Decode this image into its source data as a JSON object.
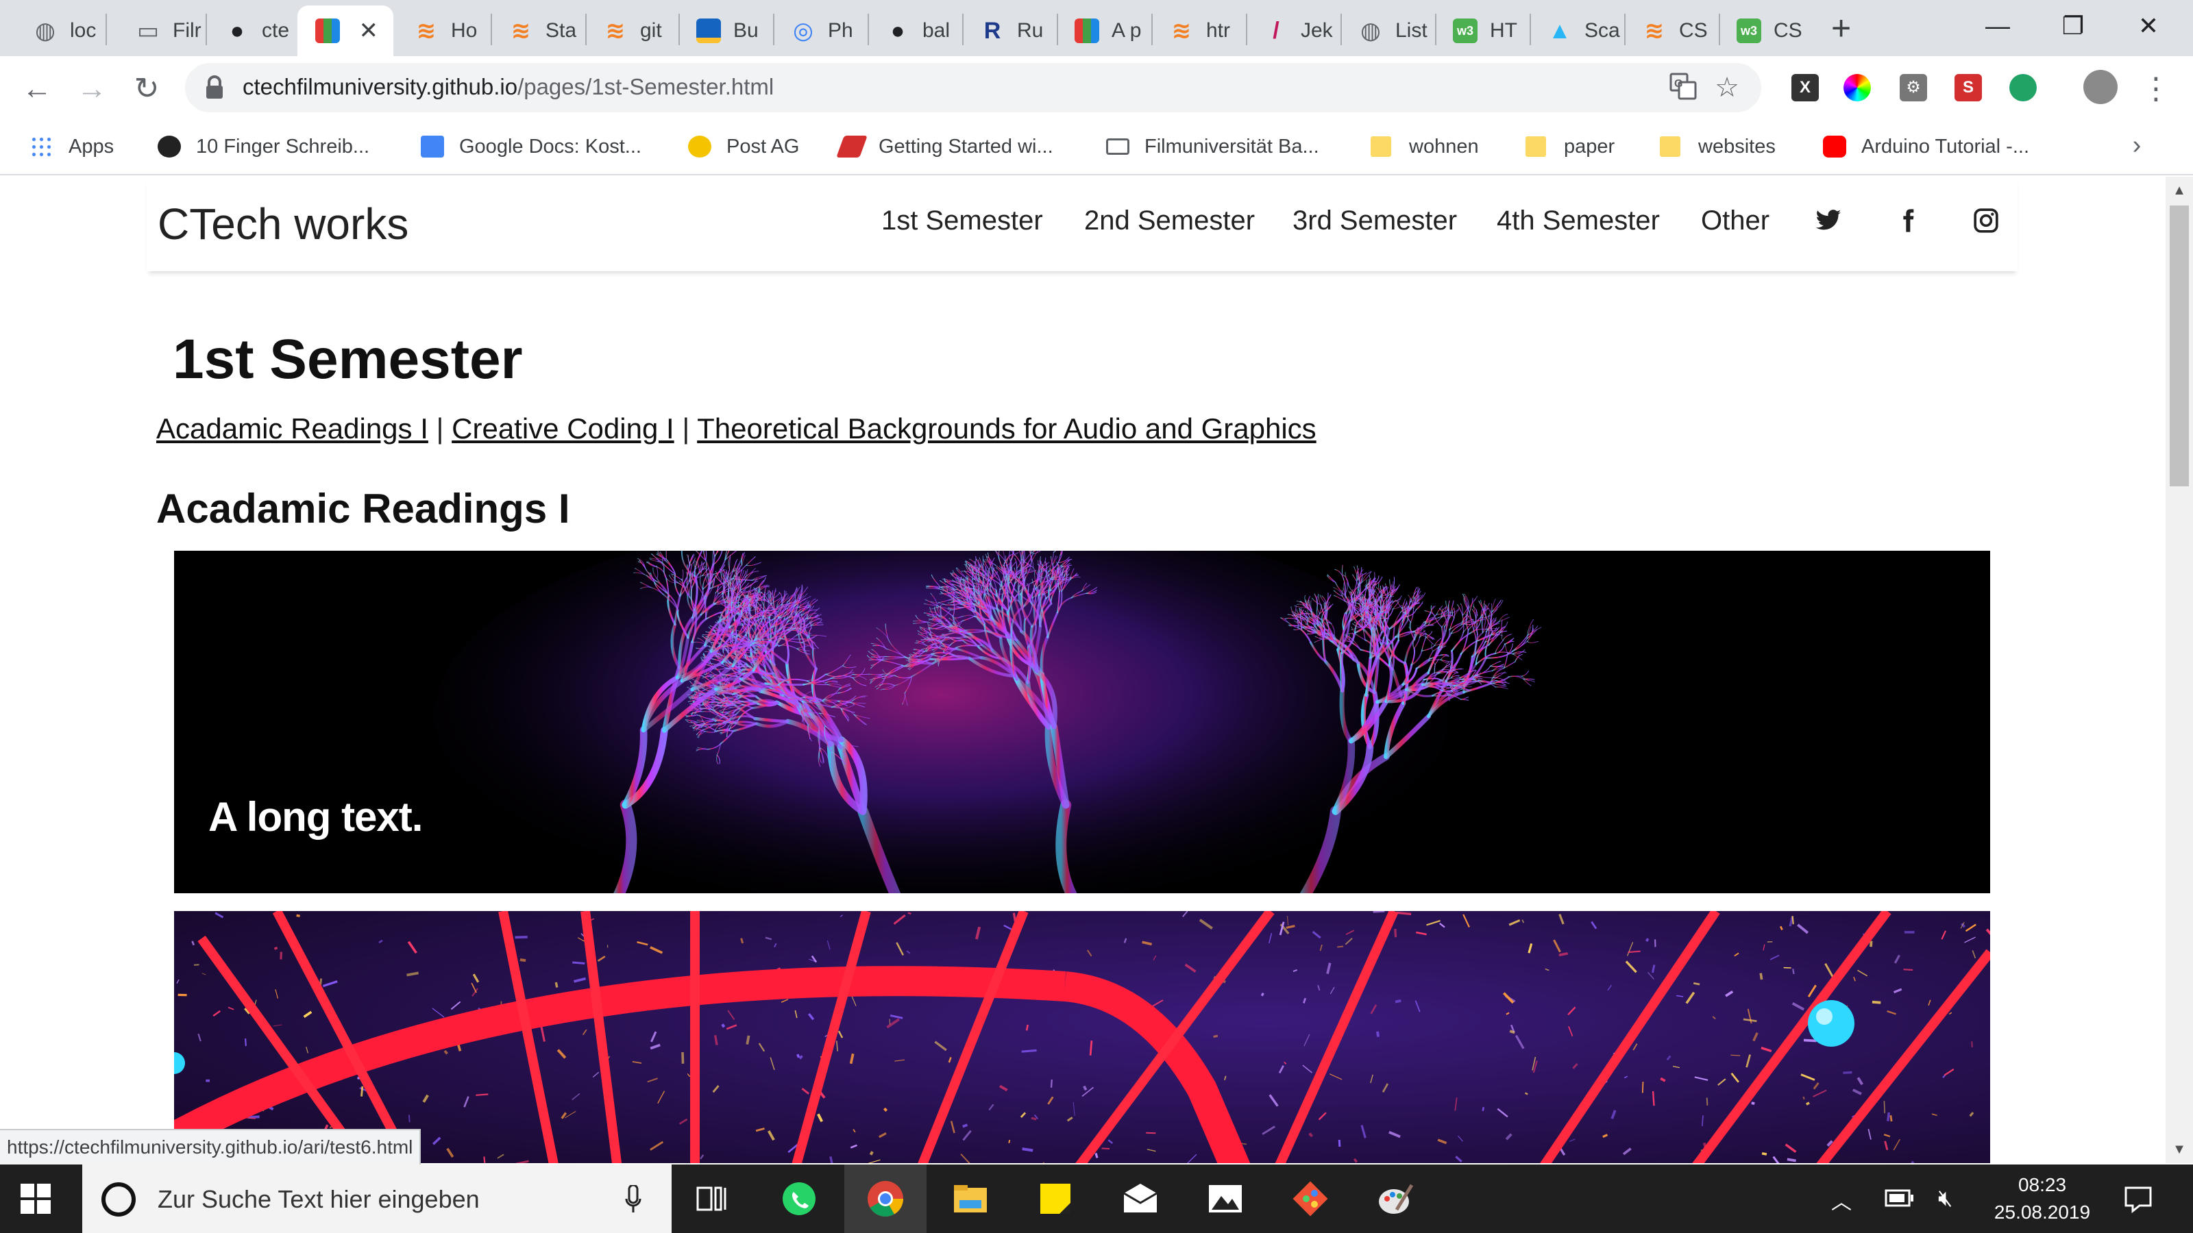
{
  "browser": {
    "tabs": [
      {
        "title": "loc",
        "icon": "globe-icon",
        "color": "#5f6368"
      },
      {
        "title": "Filr",
        "icon": "page-icon",
        "color": "#5f6368"
      },
      {
        "title": "cte",
        "icon": "github-icon",
        "color": "#202124"
      },
      {
        "title": "",
        "icon": "colorful-squares-icon",
        "color": "#e91e63",
        "active": true
      },
      {
        "title": "Ho",
        "icon": "stackoverflow-icon",
        "color": "#f48024"
      },
      {
        "title": "Sta",
        "icon": "stackoverflow-icon",
        "color": "#f48024"
      },
      {
        "title": "git",
        "icon": "stackoverflow-icon",
        "color": "#f48024"
      },
      {
        "title": "Bu",
        "icon": "blue-box-icon",
        "color": "#1565c0"
      },
      {
        "title": "Ph",
        "icon": "photo-icon",
        "color": "#3b82f6"
      },
      {
        "title": "bal",
        "icon": "github-icon",
        "color": "#202124"
      },
      {
        "title": "Ru",
        "icon": "r-icon",
        "color": "#1e3a8a"
      },
      {
        "title": "A p",
        "icon": "colorful-squares-icon",
        "color": "#e91e63"
      },
      {
        "title": "htr",
        "icon": "stackoverflow-icon",
        "color": "#f48024"
      },
      {
        "title": "Jek",
        "icon": "jekyll-icon",
        "color": "#c2185b"
      },
      {
        "title": "List",
        "icon": "globe-icon",
        "color": "#5f6368"
      },
      {
        "title": "HT",
        "icon": "w3-icon",
        "color": "#4caf50"
      },
      {
        "title": "Sca",
        "icon": "sca-icon",
        "color": "#29b6f6"
      },
      {
        "title": "CS",
        "icon": "stackoverflow-icon",
        "color": "#f48024"
      },
      {
        "title": "CS",
        "icon": "w3-icon",
        "color": "#4caf50"
      }
    ],
    "close_tab_glyph": "✕",
    "new_tab_glyph": "+",
    "url_host": "ctechfilmuniversity.github.io",
    "url_path": "/pages/1st-Semester.html",
    "bookmarks": [
      {
        "label": "Apps",
        "icon": "apps-grid-icon"
      },
      {
        "label": "10 Finger Schreib...",
        "icon": "typing-icon"
      },
      {
        "label": "Google Docs: Kost...",
        "icon": "docs-icon"
      },
      {
        "label": "Post AG",
        "icon": "post-icon"
      },
      {
        "label": "Getting Started wi...",
        "icon": "getting-started-icon"
      },
      {
        "label": "Filmuniversität Ba...",
        "icon": "page-icon"
      },
      {
        "label": "wohnen",
        "icon": "folder-icon"
      },
      {
        "label": "paper",
        "icon": "folder-icon"
      },
      {
        "label": "websites",
        "icon": "folder-icon"
      },
      {
        "label": "Arduino Tutorial -...",
        "icon": "youtube-icon"
      }
    ]
  },
  "site": {
    "brand": "CTech works",
    "nav": [
      "1st Semester",
      "2nd Semester",
      "3rd Semester",
      "4th Semester",
      "Other"
    ],
    "page_title": "1st Semester",
    "sub_links": [
      "Acadamic Readings I",
      "Creative Coding I",
      "Theoretical Backgrounds for Audio and Graphics"
    ],
    "separator": "|",
    "section_title": "Acadamic Readings I",
    "hero1_caption": "A long text."
  },
  "status_url": "https://ctechfilmuniversity.github.io/ari/test6.html",
  "taskbar": {
    "search_placeholder": "Zur Suche Text hier eingeben",
    "time": "08:23",
    "date": "25.08.2019"
  }
}
